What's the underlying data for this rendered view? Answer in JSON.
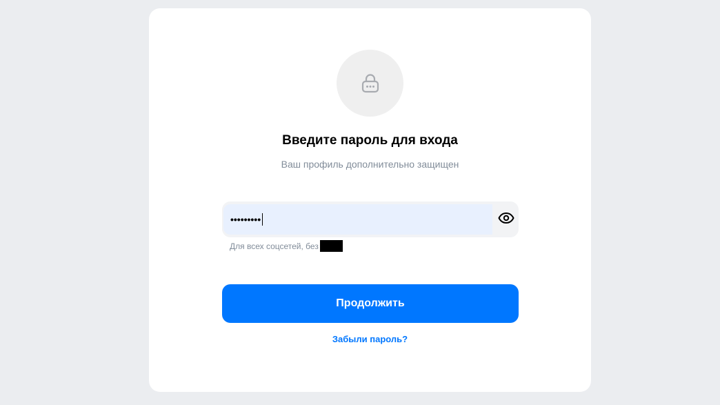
{
  "auth": {
    "avatar_icon": "lock-icon",
    "title": "Введите пароль для входа",
    "subtitle": "Ваш профиль дополнительно защищен",
    "password": {
      "masked_value": "•••••••••",
      "toggle_icon": "eye-icon"
    },
    "hint": "Для всех соцсетей, без",
    "continue_label": "Продолжить",
    "forgot_label": "Забыли пароль?"
  },
  "colors": {
    "page_bg": "#ebedf0",
    "card_bg": "#ffffff",
    "accent": "#0077ff",
    "muted_text": "#818c99",
    "input_bg": "#e8f0fe"
  }
}
